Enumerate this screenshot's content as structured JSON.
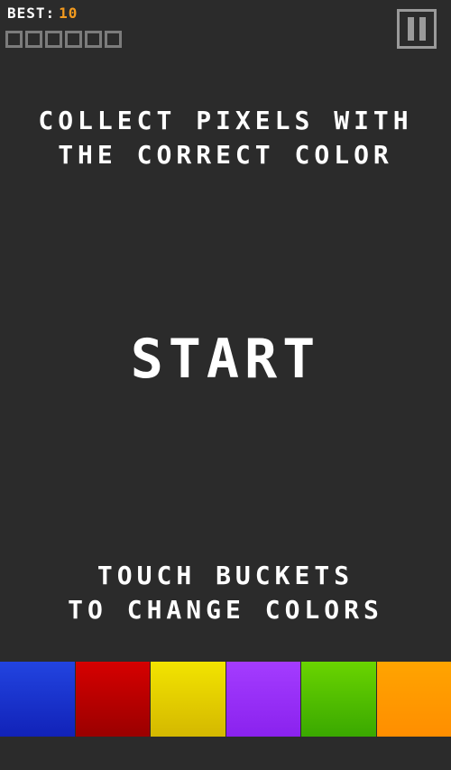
{
  "hud": {
    "best_label": "BEST:",
    "best_value": "10",
    "best_color": "#f39a1e",
    "progress_slots_total": 6,
    "progress_slots_filled": 0
  },
  "pause": {
    "icon": "pause-icon"
  },
  "instructions": {
    "top_line1": "COLLECT PIXELS WITH",
    "top_line2": "THE CORRECT COLOR",
    "start": "START",
    "bottom_line1": "TOUCH BUCKETS",
    "bottom_line2": "TO CHANGE COLORS"
  },
  "buckets": [
    {
      "name": "blue",
      "top": "#2244e0",
      "bottom": "#1122b8"
    },
    {
      "name": "red",
      "top": "#d60000",
      "bottom": "#9a0000"
    },
    {
      "name": "yellow",
      "top": "#f2e400",
      "bottom": "#d4b800"
    },
    {
      "name": "purple",
      "top": "#a43cff",
      "bottom": "#8a22ee"
    },
    {
      "name": "green",
      "top": "#6ad400",
      "bottom": "#3aa800"
    },
    {
      "name": "orange",
      "top": "#ffa400",
      "bottom": "#ff8e00"
    }
  ]
}
